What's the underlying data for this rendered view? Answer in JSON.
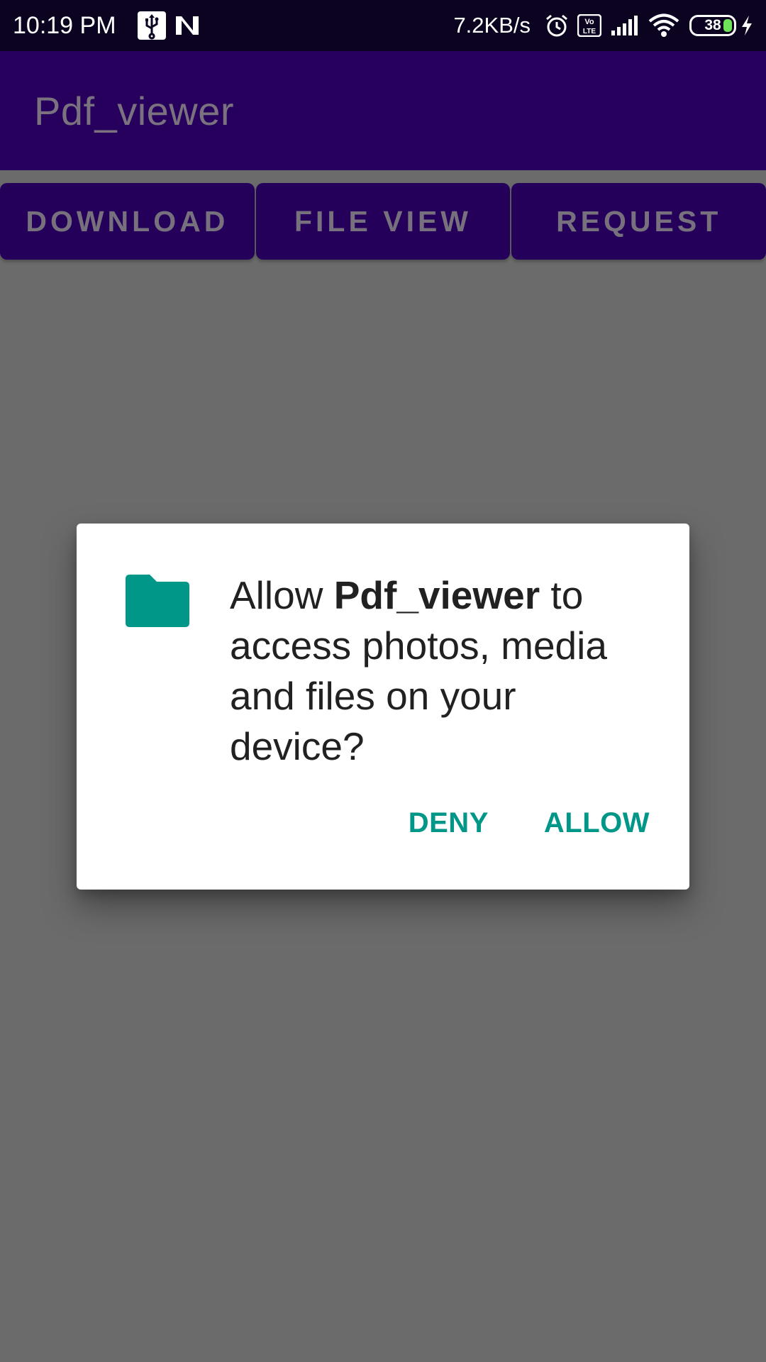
{
  "status_bar": {
    "time": "10:19 PM",
    "net_speed": "7.2KB/s",
    "volte_label": "Vo\nLTE",
    "battery_level": "38",
    "icons": [
      "usb-icon",
      "n-notification-icon",
      "alarm-icon",
      "volte-icon",
      "signal-icon",
      "wifi-icon",
      "battery-icon",
      "charging-icon"
    ]
  },
  "app_bar": {
    "title": "Pdf_viewer"
  },
  "buttons": [
    {
      "label": "DOWNLOAD"
    },
    {
      "label": "FILE VIEW"
    },
    {
      "label": "REQUEST"
    }
  ],
  "permission_dialog": {
    "message_prefix": "Allow ",
    "app_name": "Pdf_viewer",
    "message_suffix": " to access photos, media and files on your device?",
    "icon": "folder-icon",
    "deny_label": "DENY",
    "allow_label": "ALLOW"
  },
  "colors": {
    "status_bar": "#0c0320",
    "app_bar": "#27005e",
    "button_bg": "#24005a",
    "scrim": "#6b6b6b",
    "accent": "#009688"
  }
}
